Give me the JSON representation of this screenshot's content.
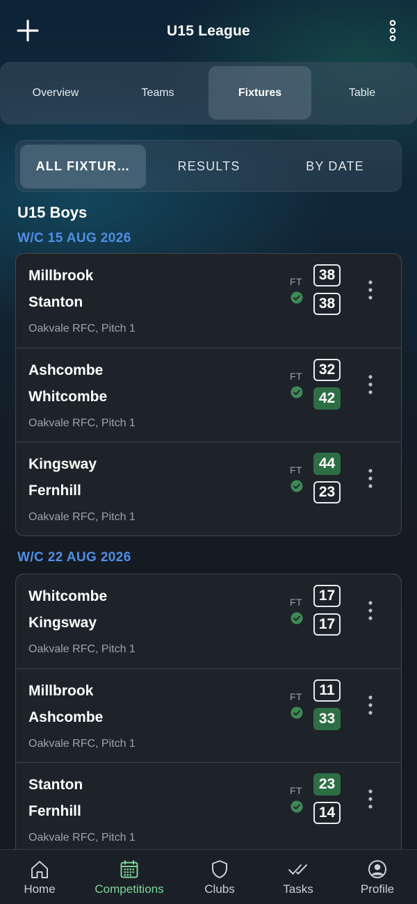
{
  "header": {
    "title": "U15 League",
    "add_icon": "plus-icon",
    "more_icon": "more-vertical-icon"
  },
  "tabs": [
    {
      "label": "Overview",
      "active": false
    },
    {
      "label": "Teams",
      "active": false
    },
    {
      "label": "Fixtures",
      "active": true
    },
    {
      "label": "Table",
      "active": false
    }
  ],
  "subtabs": [
    {
      "label": "ALL FIXTUR…",
      "active": true
    },
    {
      "label": "RESULTS",
      "active": false
    },
    {
      "label": "BY DATE",
      "active": false
    }
  ],
  "section_title": "U15 Boys",
  "weeks": [
    {
      "label": "W/C 15 AUG 2026",
      "fixtures": [
        {
          "home": "Millbrook",
          "away": "Stanton",
          "venue": "Oakvale RFC, Pitch 1",
          "status": "FT",
          "home_score": "38",
          "away_score": "38",
          "winner": "none"
        },
        {
          "home": "Ashcombe",
          "away": "Whitcombe",
          "venue": "Oakvale RFC, Pitch 1",
          "status": "FT",
          "home_score": "32",
          "away_score": "42",
          "winner": "away"
        },
        {
          "home": "Kingsway",
          "away": "Fernhill",
          "venue": "Oakvale RFC, Pitch 1",
          "status": "FT",
          "home_score": "44",
          "away_score": "23",
          "winner": "home"
        }
      ]
    },
    {
      "label": "W/C 22 AUG 2026",
      "fixtures": [
        {
          "home": "Whitcombe",
          "away": "Kingsway",
          "venue": "Oakvale RFC, Pitch 1",
          "status": "FT",
          "home_score": "17",
          "away_score": "17",
          "winner": "none"
        },
        {
          "home": "Millbrook",
          "away": "Ashcombe",
          "venue": "Oakvale RFC, Pitch 1",
          "status": "FT",
          "home_score": "11",
          "away_score": "33",
          "winner": "away"
        },
        {
          "home": "Stanton",
          "away": "Fernhill",
          "venue": "Oakvale RFC, Pitch 1",
          "status": "FT",
          "home_score": "23",
          "away_score": "14",
          "winner": "home"
        }
      ]
    }
  ],
  "bottom_nav": [
    {
      "label": "Home",
      "icon": "home-icon",
      "active": false
    },
    {
      "label": "Competitions",
      "icon": "calendar-icon",
      "active": true
    },
    {
      "label": "Clubs",
      "icon": "shield-icon",
      "active": false
    },
    {
      "label": "Tasks",
      "icon": "double-check-icon",
      "active": false
    },
    {
      "label": "Profile",
      "icon": "profile-icon",
      "active": false
    }
  ],
  "colors": {
    "accent_green": "#7fd79a",
    "win_green": "#2e6e45",
    "week_blue": "#4f8fe6",
    "card_bg": "#1e2329"
  }
}
